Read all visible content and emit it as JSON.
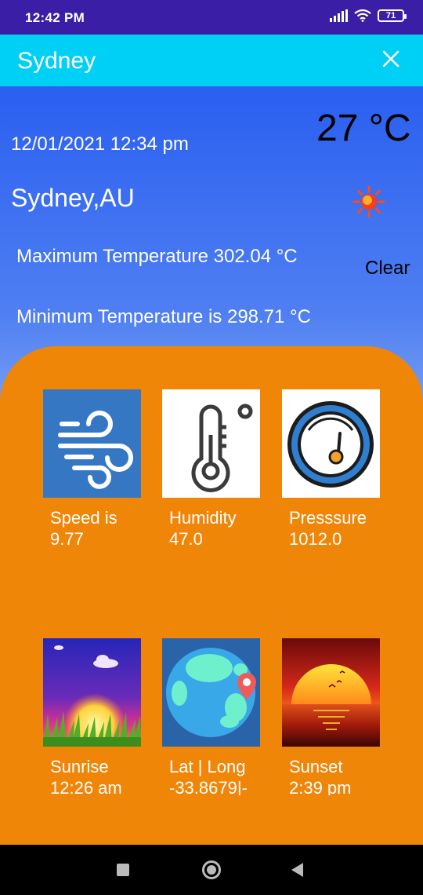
{
  "status_bar": {
    "time": "12:42 PM",
    "battery": "71"
  },
  "app_bar": {
    "title": "Sydney"
  },
  "weather": {
    "temperature": "27 °C",
    "datetime": "12/01/2021 12:34 pm",
    "location": "Sydney,AU",
    "max_temp": "Maximum Temperature 302.04 °C",
    "min_temp": "Minimum Temperature is 298.71 °C",
    "condition": "Clear"
  },
  "tiles": [
    {
      "line1": "Speed is",
      "line2": "9.77",
      "icon": "wind-icon"
    },
    {
      "line1": "Humidity",
      "line2": "47.0",
      "icon": "thermometer-icon"
    },
    {
      "line1": "Presssure",
      "line2": "1012.0",
      "icon": "pressure-gauge-icon"
    },
    {
      "line1": "Sunrise",
      "line2": "12:26 am",
      "icon": "sunrise-icon"
    },
    {
      "line1": "Lat | Long",
      "line2": "-33.8679|-",
      "icon": "globe-location-icon"
    },
    {
      "line1": "Sunset",
      "line2": "2:39 pm",
      "icon": "sunset-icon"
    }
  ],
  "colors": {
    "status_bar": "#3a1fa6",
    "app_bar": "#00d0f5",
    "card": "#ef8608"
  }
}
